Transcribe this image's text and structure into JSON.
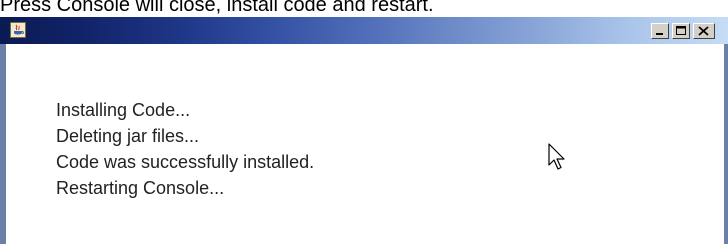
{
  "page": {
    "caption_text": "Press Console will close, install code and restart."
  },
  "window": {
    "titlebar": {
      "app_icon": "java-icon",
      "controls": {
        "minimize_icon": "minimize-icon",
        "maximize_icon": "maximize-icon",
        "close_icon": "close-icon"
      },
      "colors": {
        "gradient_start": "#0a1a52",
        "gradient_end": "#c6dcf6"
      }
    },
    "log_lines": [
      "Installing Code...",
      "Deleting jar files...",
      "Code was successfully installed.",
      "Restarting Console..."
    ]
  },
  "cursor": {
    "icon": "mouse-pointer-icon"
  }
}
